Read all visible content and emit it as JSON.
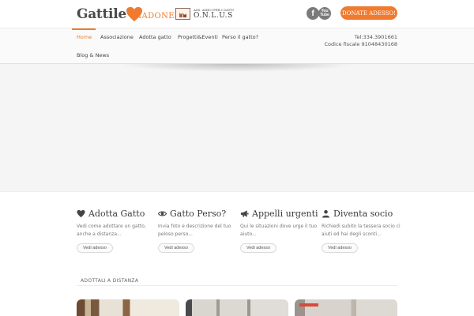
{
  "header": {
    "logo_word": "Gattile",
    "logo_sub": "MADONE",
    "onlus_small": "ASS. AMICI PER I GATTI",
    "onlus_big": "O.N.L.U.S",
    "facebook_glyph": "f",
    "youtube_glyph": "You Tube",
    "donate_label": "DONATE ADESSO!"
  },
  "nav": {
    "items": [
      "Home",
      "Associazione",
      "Adotta gatto",
      "Progetti&Eventi",
      "Perso il gatto?",
      "Blog & News"
    ],
    "phone": "Tel:334.3901661",
    "fiscal": "Codice fiscale 91048430168"
  },
  "features": [
    {
      "icon": "heart-icon",
      "title": "Adotta Gatto",
      "desc": "Vedi come adottare un gatto, anche a distanza...",
      "button": "Vedi adesso"
    },
    {
      "icon": "eye-icon",
      "title": "Gatto Perso?",
      "desc": "Invia foto e descrizione del tuo peloso perso...",
      "button": "Vedi adesso"
    },
    {
      "icon": "megaphone-icon",
      "title": "Appelli urgenti",
      "desc": "Qui le situazioni dove urge il tuo aiuto...",
      "button": "Vedi adesso"
    },
    {
      "icon": "user-icon",
      "title": "Diventa socio",
      "desc": "Richiedi subito la tessera socio ci aiuti ed hai degli sconti...",
      "button": "Vedi adesso"
    }
  ],
  "section": {
    "label": "ADOTTALI A DISTANZA"
  },
  "colors": {
    "accent": "#f07a2e",
    "text": "#3a3a3a"
  }
}
